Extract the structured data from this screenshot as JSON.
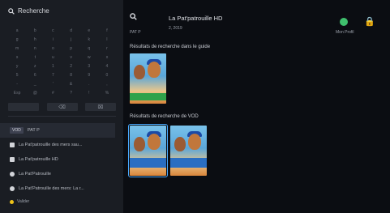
{
  "search": {
    "title": "Recherche"
  },
  "keyboard": {
    "rows": [
      [
        "a",
        "b",
        "c",
        "d",
        "e",
        "f"
      ],
      [
        "g",
        "h",
        "i",
        "j",
        "k",
        "l"
      ],
      [
        "m",
        "n",
        "o",
        "p",
        "q",
        "r"
      ],
      [
        "s",
        "t",
        "u",
        "v",
        "w",
        "x"
      ],
      [
        "y",
        "z",
        "1",
        "2",
        "3",
        "4"
      ],
      [
        "5",
        "6",
        "7",
        "8",
        "9",
        "0"
      ],
      [
        "-",
        "_",
        "'",
        "&",
        ".",
        ","
      ],
      [
        "Esp",
        "@",
        "#",
        "?",
        "!",
        "%"
      ]
    ],
    "bottom_keys": [
      "",
      "⌫",
      "⌧"
    ]
  },
  "results": [
    {
      "tag": "VOD",
      "label": "PAT P",
      "icon": "square"
    },
    {
      "label": "La Pat'patrouille des mers sau...",
      "icon": "square"
    },
    {
      "label": "La Pat'patrouille HD",
      "icon": "square"
    },
    {
      "label": "La Pat'Patrouille",
      "icon": "round"
    },
    {
      "label": "La Pat'Patrouille des mers: La r...",
      "icon": "round"
    }
  ],
  "hint": "Valider",
  "main": {
    "query": "PAT P",
    "title": "La Pat'patrouille HD",
    "year": "2, 2019",
    "user_label": "Mon Profil",
    "section_guide": "Résultats de recherche dans le guide",
    "section_vod": "Résultats de recherche de VOD"
  },
  "colors": {
    "accent": "#47a9ff",
    "hint_dot": "#f0c419",
    "user": "#3fbf6d"
  }
}
